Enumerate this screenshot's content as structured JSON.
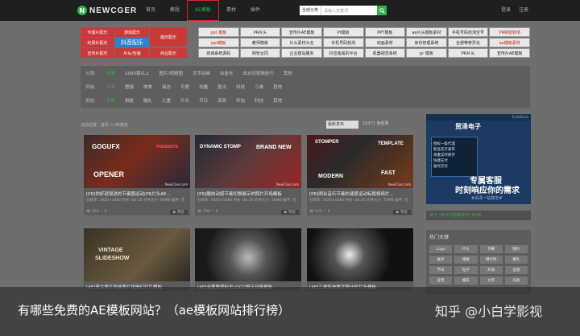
{
  "header": {
    "logo_text": "NEWCGER",
    "nav": [
      "首页",
      "教程",
      "AE模板",
      "素材",
      "插件"
    ],
    "nav_active_index": 2,
    "search_category": "全部分类",
    "search_placeholder": "请输入关键词",
    "login": "登录",
    "register": "注册"
  },
  "colors": {
    "accent": "#2db34a",
    "tag_red": "#c83a3a",
    "tag_blue": "#2e7fd0",
    "highlight_box": "#dd2222"
  },
  "left_tags": {
    "red": [
      "专题片配乐",
      "游戏配乐",
      "婚庆配乐",
      "纪录片配乐",
      "宣传片配乐",
      "片头/包装",
      "商业配乐"
    ],
    "blue": "抖音配乐"
  },
  "tag_grid": [
    "ppt 模板",
    "PR片头",
    "宣传片AE模板",
    "Pr模板",
    "PPT模板",
    "ae片头模板素材",
    "手机号码检测空号",
    "PR特效转场",
    "ppt模板",
    "教师模板",
    "片头素材大全",
    "手机号码检测",
    "动画素材",
    "身份管理系统",
    "全部带奇异化",
    "ae模板素材",
    "商城系统源码",
    "网管合同",
    "企业建站服务",
    "抖音金属的平台",
    "机器视觉系统",
    "pr 模板",
    "PR片头",
    "宣传片AE模板"
  ],
  "tag_grid_highlight": [
    0,
    7,
    8,
    15
  ],
  "filter": {
    "rows": [
      {
        "label": "分类:",
        "options": [
          "不限",
          "1000套以上",
          "图片/视频图",
          "文字动画",
          "合金光",
          "去水印剪辑技巧",
          "其他"
        ]
      },
      {
        "label": "风格:",
        "options": [
          "不限",
          "震撼",
          "唯美",
          "简洁",
          "可爱",
          "炫酷",
          "复古",
          "科技",
          "三维",
          "其他"
        ]
      },
      {
        "label": "用途:",
        "options": [
          "不限",
          "相册",
          "婚礼",
          "儿童",
          "片头",
          "节日",
          "商务",
          "栏包",
          "科技",
          "其他"
        ]
      }
    ]
  },
  "toolbar": {
    "breadcrumb": "当前位置：首页 > AE模板",
    "sort_label": "最新发布",
    "count": "16371 条结果"
  },
  "cards": [
    {
      "title": "[PR]你好就很进的节奏图运动(PR片头AE...",
      "thumb": "GOGUFX · OPENER",
      "meta": "分辨率: 1920×1080  时长: 00:15  文件大小: 89MB  插件: 无",
      "views": "252",
      "likes": "0"
    },
    {
      "title": "[PR]酷炫动感节奏切换展示的照片开场模板",
      "thumb": "DYNAMIC STOMP · BRAND NEW",
      "meta": "分辨率: 1920×1080  时长: 00:30  文件大小: 56MB  插件: 无",
      "views": "190",
      "likes": "0"
    },
    {
      "title": "[PR]明合音乐节奏的速度运动标题视频片...",
      "thumb": "STOMPER · TEMPLATE · MODERN · FAST",
      "meta": "分辨率: 1920×1080  时长: 00:20  文件大小: 72MB  插件: 无",
      "views": "175",
      "likes": "0"
    },
    {
      "title": "[AE]复古胶片风格照片相册幻灯片模板",
      "thumb": "VINTAGE SLIDESHOW",
      "meta": "",
      "views": "",
      "likes": ""
    },
    {
      "title": "[AE]金属质感标志LOGO展示动画模板",
      "thumb": "",
      "meta": "",
      "views": "",
      "likes": ""
    },
    {
      "title": "[AE]三维科技数字倒计时片头模板",
      "thumb": "333+",
      "meta": "",
      "views": "",
      "likes": ""
    }
  ],
  "card_play_label": "▶ 预览",
  "card_watermark": "NewCGer.com",
  "ad": {
    "top": "TradeDesk",
    "brand": "贸泽电子",
    "features": [
      "· 授权一级代理",
      "· 新品先行发布",
      "· 海量实时库存",
      "· 快捷支付",
      "· 准时交付"
    ],
    "big1": "专属客服",
    "big2": "时刻响应你的需求",
    "small": "#贸泽一站搞定#",
    "caption": "关于 \"去水印剪辑技巧\" 的AE"
  },
  "hot": {
    "title": "热门关键",
    "tags": [
      "Logo",
      "片头",
      "字幕",
      "图片",
      "展示",
      "相册",
      "倒计时",
      "婚礼",
      "节日",
      "粒子",
      "开场",
      "促销",
      "宣传",
      "婚庆",
      "文字",
      "光效"
    ]
  },
  "overlay": {
    "title": "有哪些免费的AE模板网站？（ae模板网站排行榜）",
    "brand": "知乎 @小白学影视"
  }
}
